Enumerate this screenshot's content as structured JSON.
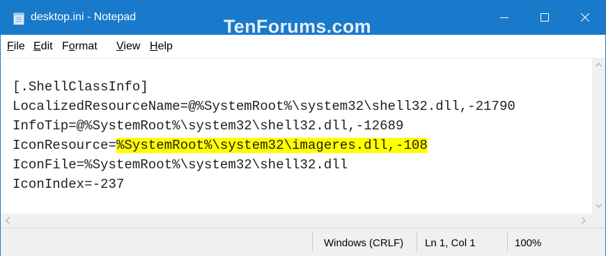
{
  "window": {
    "title": "desktop.ini - Notepad",
    "watermark": "TenForums.com",
    "accent_color": "#1979ca",
    "app_icon": "notepad-icon"
  },
  "controls": [
    "minimize-icon",
    "maximize-icon",
    "close-icon"
  ],
  "menu": [
    {
      "accel": "F",
      "rest": "ile"
    },
    {
      "accel": "E",
      "rest": "dit"
    },
    {
      "accel": "o",
      "pre": "F",
      "rest": "rmat"
    },
    {
      "accel": "V",
      "rest": "iew"
    },
    {
      "accel": "H",
      "rest": "elp"
    }
  ],
  "editor": {
    "lines": [
      "[.ShellClassInfo]",
      "LocalizedResourceName=@%SystemRoot%\\system32\\shell32.dll,-21790",
      "InfoTip=@%SystemRoot%\\system32\\shell32.dll,-12689",
      "IconResource=",
      "IconFile=%SystemRoot%\\system32\\shell32.dll",
      "IconIndex=-237"
    ],
    "highlight_text": "%SystemRoot%\\system32\\imageres.dll,-108",
    "highlight_color": "#ffff00"
  },
  "status": {
    "line_ending": "Windows (CRLF)",
    "position": "Ln 1, Col 1",
    "zoom": "100%"
  }
}
